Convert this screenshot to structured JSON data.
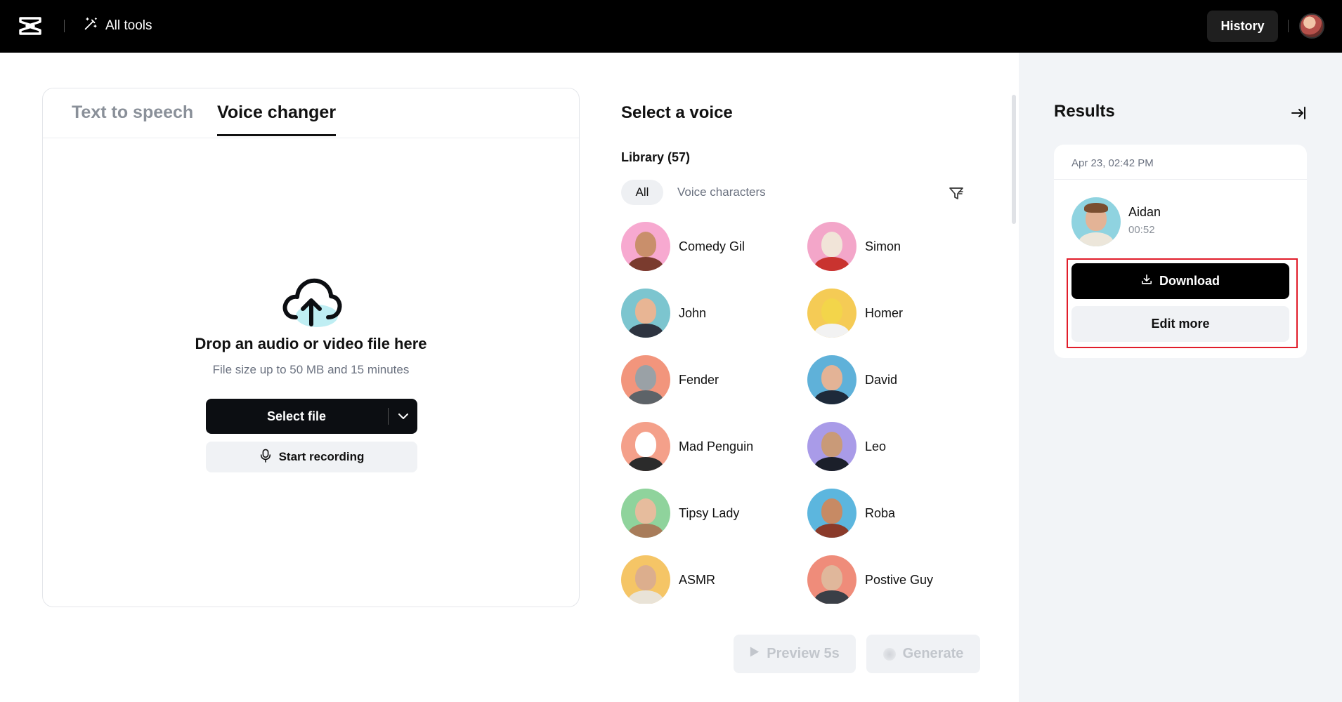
{
  "header": {
    "all_tools_label": "All tools",
    "history_label": "History"
  },
  "tabs": [
    {
      "label": "Text to speech",
      "active": false
    },
    {
      "label": "Voice changer",
      "active": true
    }
  ],
  "upload": {
    "title": "Drop an audio or video file here",
    "subtitle": "File size up to 50 MB and 15 minutes",
    "select_file_label": "Select file",
    "start_recording_label": "Start recording"
  },
  "voice_panel": {
    "title": "Select a voice",
    "library_label": "Library (57)",
    "filters": [
      "All",
      "Voice characters"
    ],
    "active_filter": "All",
    "voices": [
      {
        "name": "Comedy Gil",
        "bg": "#f7a9d0",
        "skin": "#c98f6b",
        "shirt": "#7a3b2e"
      },
      {
        "name": "Simon",
        "bg": "#f3a6c9",
        "skin": "#f1e4d8",
        "shirt": "#c9332f"
      },
      {
        "name": "John",
        "bg": "#7cc5cf",
        "skin": "#e8b594",
        "shirt": "#2e3440"
      },
      {
        "name": "Homer",
        "bg": "#f5cb55",
        "skin": "#f3d54a",
        "shirt": "#f2f2f2"
      },
      {
        "name": "Fender",
        "bg": "#f2957c",
        "skin": "#9aa1a6",
        "shirt": "#5d6368"
      },
      {
        "name": "David",
        "bg": "#5fb1d9",
        "skin": "#e3b396",
        "shirt": "#1e2a3a"
      },
      {
        "name": "Mad Penguin",
        "bg": "#f4a08a",
        "skin": "#ffffff",
        "shirt": "#2b2b2b"
      },
      {
        "name": "Leo",
        "bg": "#a99be8",
        "skin": "#c99a78",
        "shirt": "#1b1f2a"
      },
      {
        "name": "Tipsy Lady",
        "bg": "#8fd39c",
        "skin": "#e6bc9d",
        "shirt": "#a87c5a"
      },
      {
        "name": "Roba",
        "bg": "#5cb6de",
        "skin": "#c78a64",
        "shirt": "#8a3a2a"
      },
      {
        "name": "ASMR",
        "bg": "#f5c566",
        "skin": "#dcae8d",
        "shirt": "#e9e3d7"
      },
      {
        "name": "Postive Guy",
        "bg": "#ef8c7a",
        "skin": "#e0b79b",
        "shirt": "#3a3f47"
      }
    ],
    "preview_label": "Preview 5s",
    "generate_label": "Generate"
  },
  "results": {
    "title": "Results",
    "items": [
      {
        "date": "Apr 23, 02:42 PM",
        "voice_name": "Aidan",
        "duration": "00:52",
        "download_label": "Download",
        "edit_more_label": "Edit more"
      }
    ]
  },
  "colors": {
    "topbar": "#000000",
    "primary_button": "#0c0e12",
    "secondary_button": "#f0f2f5",
    "results_bg": "#f2f4f7",
    "highlight": "#e11d2a"
  }
}
